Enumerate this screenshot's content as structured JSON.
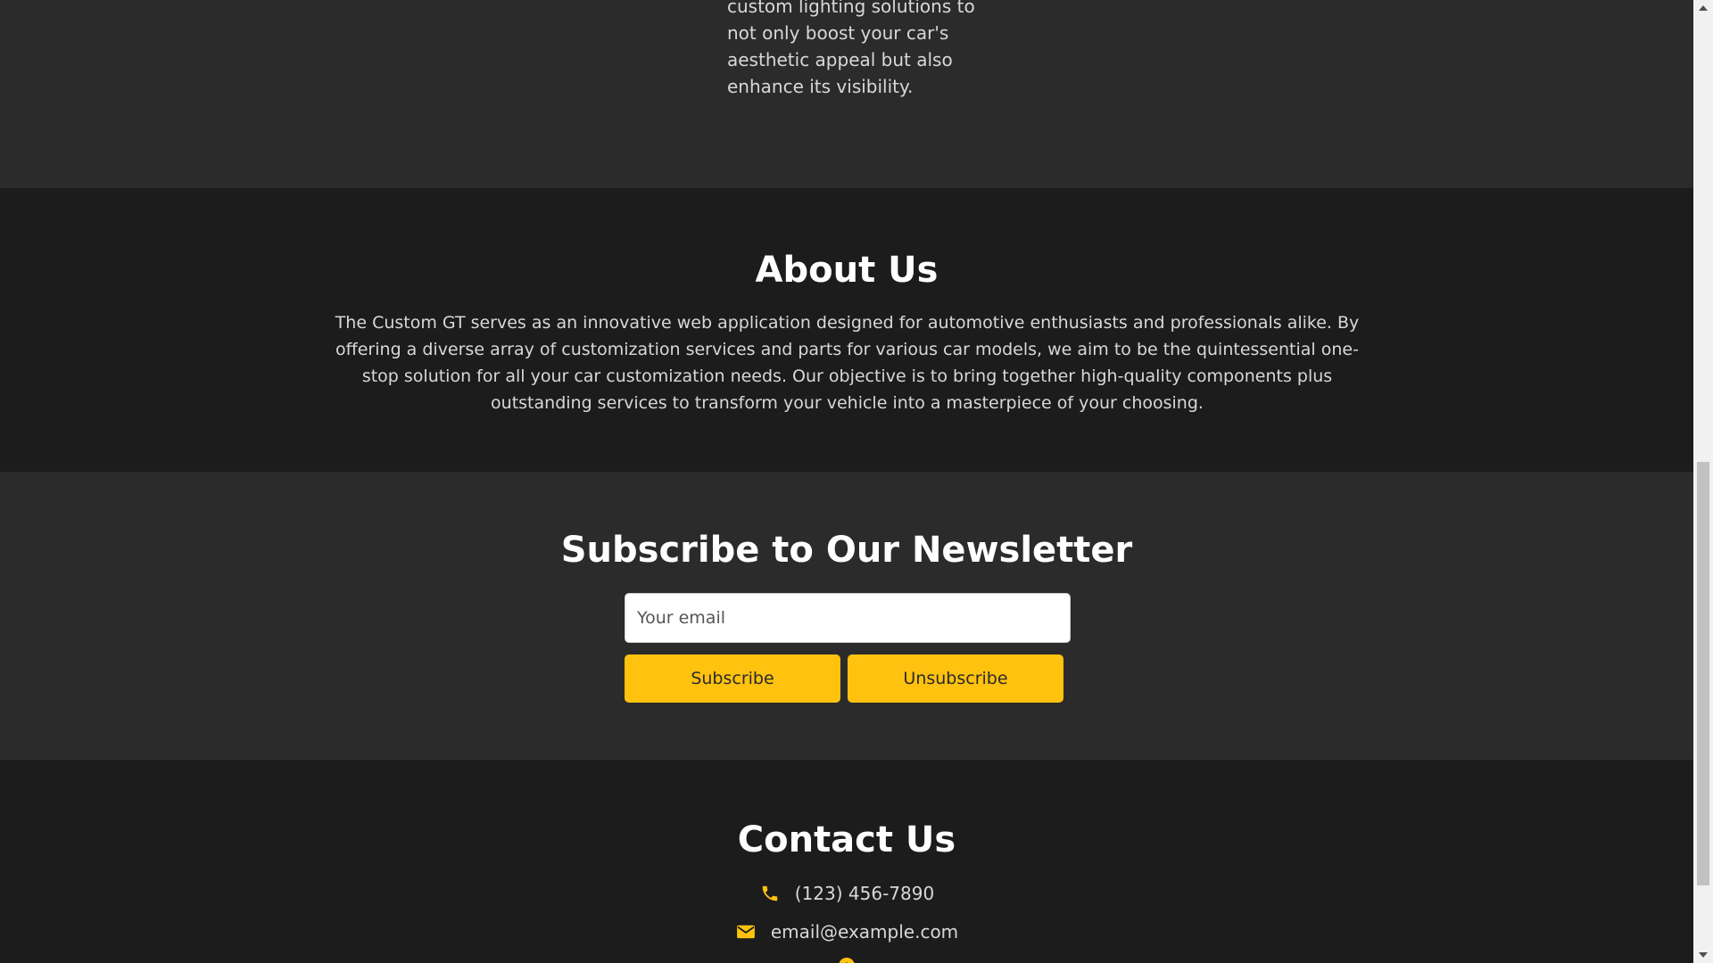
{
  "services": {
    "description": "custom lighting solutions to not only boost your car's aesthetic appeal but also enhance its visibility."
  },
  "about": {
    "title": "About Us",
    "body": "The Custom GT serves as an innovative web application designed for automotive enthusiasts and professionals alike. By offering a diverse array of customization services and parts for various car models, we aim to be the quintessential one-stop solution for all your car customization needs. Our objective is to bring together high-quality components plus outstanding services to transform your vehicle into a masterpiece of your choosing."
  },
  "newsletter": {
    "title": "Subscribe to Our Newsletter",
    "email_placeholder": "Your email",
    "subscribe_label": "Subscribe",
    "unsubscribe_label": "Unsubscribe"
  },
  "contact": {
    "title": "Contact Us",
    "phone": "(123) 456-7890",
    "email": "email@example.com",
    "phone_icon": "phone-icon",
    "email_icon": "envelope-icon",
    "address_icon": "map-marker-icon"
  },
  "colors": {
    "accent": "#ffc20e",
    "section_dark": "#1c1c1c",
    "section_mid": "#2b2b2b"
  }
}
